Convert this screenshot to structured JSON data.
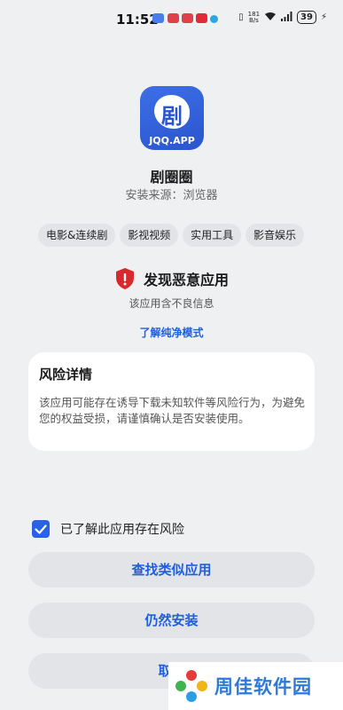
{
  "status": {
    "time": "11:52",
    "net_speed_value": "181",
    "net_speed_unit": "B/s",
    "battery": "39"
  },
  "app": {
    "name": "剧圈圈",
    "source": "安装来源：浏览器",
    "icon_glyph": "剧",
    "icon_text": "JQQ.APP",
    "icon_color": "#2a55cf"
  },
  "tags": [
    "电影&连续剧",
    "影视视频",
    "实用工具",
    "影音娱乐"
  ],
  "warning": {
    "title": "发现恶意应用",
    "subtitle": "该应用含不良信息",
    "link": "了解纯净模式",
    "shield_color": "#d8282b"
  },
  "risk": {
    "title": "风险详情",
    "body": "该应用可能存在诱导下载未知软件等风险行为，为避免您的权益受损，请谨慎确认是否安装使用。"
  },
  "consent": {
    "label": "已了解此应用存在风险",
    "checked": true
  },
  "buttons": {
    "find_similar": "查找类似应用",
    "install_anyway": "仍然安装",
    "cancel": "取消"
  },
  "watermark": {
    "text": "周佳软件园"
  },
  "colors": {
    "accent": "#1f5fdd",
    "background": "#eef0f2",
    "checkbox": "#2a62e6"
  }
}
